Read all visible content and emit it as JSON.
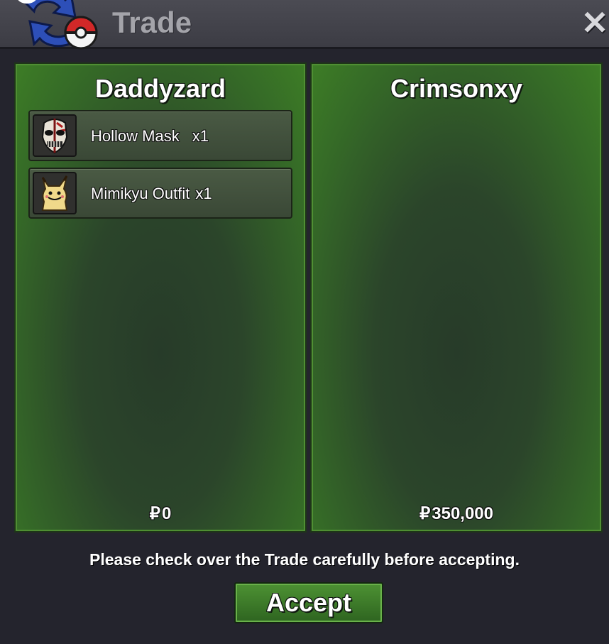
{
  "window": {
    "title": "Trade",
    "close_symbol": "✕"
  },
  "left_panel": {
    "player_name": "Daddyzard",
    "items": [
      {
        "name": "Hollow Mask",
        "quantity": "x1",
        "icon": "hollow-mask-icon"
      },
      {
        "name": "Mimikyu Outfit",
        "quantity": "x1",
        "icon": "mimikyu-outfit-icon"
      }
    ],
    "currency_symbol": "₽",
    "money": "0"
  },
  "right_panel": {
    "player_name": "Crimsonxy",
    "items": [],
    "currency_symbol": "₽",
    "money": "350,000"
  },
  "notice": "Please check over the Trade carefully before accepting.",
  "accept_label": "Accept",
  "colors": {
    "panel_green": "#3d7d26",
    "panel_dark": "#273b29",
    "titlebar": "#43434b",
    "background": "#24242d",
    "accept_green": "#4d9233"
  }
}
